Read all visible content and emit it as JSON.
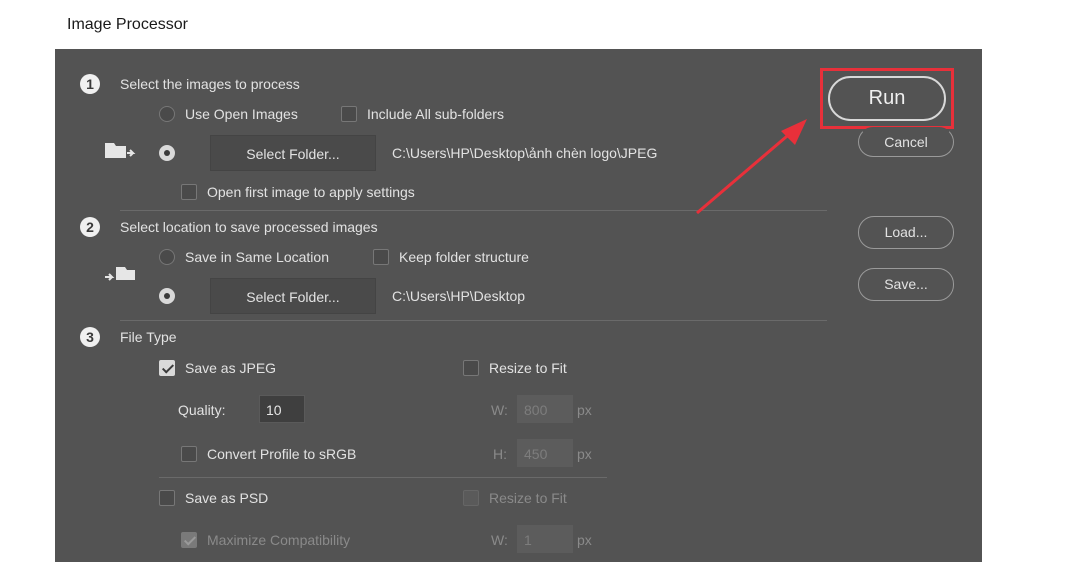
{
  "window": {
    "title": "Image Processor"
  },
  "section1": {
    "number": "1",
    "heading": "Select the images to process",
    "use_open_images": "Use Open Images",
    "include_subfolders": "Include All sub-folders",
    "select_folder_label": "Select Folder...",
    "folder_path": "C:\\Users\\HP\\Desktop\\ảnh chèn logo\\JPEG",
    "open_first_image": "Open first image to apply settings"
  },
  "section2": {
    "number": "2",
    "heading": "Select location to save processed images",
    "save_same_location": "Save in Same Location",
    "keep_folder_structure": "Keep folder structure",
    "select_folder_label": "Select Folder...",
    "folder_path": "C:\\Users\\HP\\Desktop"
  },
  "section3": {
    "number": "3",
    "heading": "File Type",
    "save_as_jpeg": "Save as JPEG",
    "quality_label": "Quality:",
    "quality_value": "10",
    "convert_profile": "Convert Profile to sRGB",
    "resize_to_fit_jpeg": "Resize to Fit",
    "jpeg_w_label": "W:",
    "jpeg_w_value": "800",
    "jpeg_h_label": "H:",
    "jpeg_h_value": "450",
    "unit": "px",
    "save_as_psd": "Save as PSD",
    "maximize_compat": "Maximize Compatibility",
    "resize_to_fit_psd": "Resize to Fit",
    "psd_w_label": "W:",
    "psd_w_value": "1"
  },
  "buttons": {
    "run": "Run",
    "cancel": "Cancel",
    "load": "Load...",
    "save": "Save..."
  },
  "colors": {
    "dialog_bg": "#535353",
    "highlight": "#e8303a",
    "arrow": "#e8303a"
  }
}
